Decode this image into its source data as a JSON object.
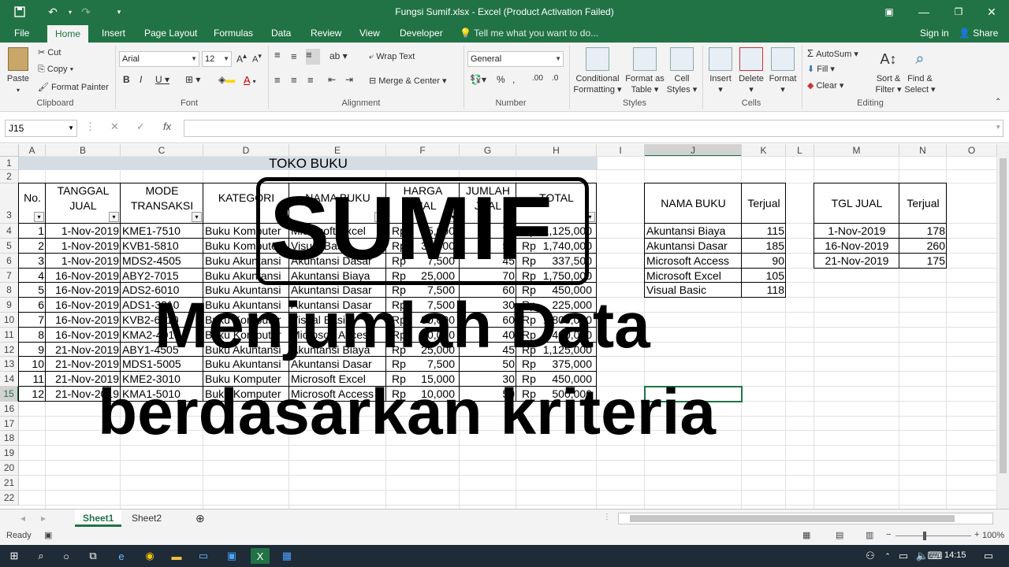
{
  "window": {
    "title": "Fungsi Sumif.xlsx - Excel (Product Activation Failed)",
    "qat": {
      "save_icon": "save-icon",
      "undo_icon": "undo-icon",
      "redo_icon": "redo-icon"
    }
  },
  "tabs": [
    "File",
    "Home",
    "Insert",
    "Page Layout",
    "Formulas",
    "Data",
    "Review",
    "View",
    "Developer"
  ],
  "tell_me": "Tell me what you want to do...",
  "sign_in": "Sign in",
  "share": "Share",
  "ribbon": {
    "clipboard": {
      "paste": "Paste",
      "cut": "Cut",
      "copy": "Copy",
      "format_painter": "Format Painter",
      "label": "Clipboard"
    },
    "font": {
      "name": "Arial",
      "size": "12",
      "label": "Font"
    },
    "alignment": {
      "wrap_text": "Wrap Text",
      "merge_center": "Merge & Center",
      "label": "Alignment"
    },
    "number": {
      "format": "General",
      "label": "Number"
    },
    "styles": {
      "conditional": "Conditional",
      "conditional2": "Formatting",
      "format_as": "Format as",
      "format_as2": "Table",
      "cell": "Cell",
      "cell2": "Styles",
      "label": "Styles"
    },
    "cells": {
      "insert": "Insert",
      "delete": "Delete",
      "format": "Format",
      "label": "Cells"
    },
    "editing": {
      "autosum": "AutoSum",
      "fill": "Fill",
      "clear": "Clear",
      "sort": "Sort &",
      "sort2": "Filter",
      "find": "Find &",
      "find2": "Select",
      "label": "Editing"
    }
  },
  "namebox": "J15",
  "columns": [
    "A",
    "B",
    "C",
    "D",
    "E",
    "F",
    "G",
    "H",
    "I",
    "J",
    "K",
    "L",
    "M",
    "N",
    "O"
  ],
  "rows": [
    "1",
    "2",
    "3",
    "4",
    "5",
    "6",
    "7",
    "8",
    "9",
    "10",
    "11",
    "12",
    "13",
    "14",
    "15",
    "16",
    "17",
    "18",
    "19",
    "20",
    "21",
    "22"
  ],
  "sheet": {
    "title": "TOKO BUKU",
    "headers": {
      "no": "No.",
      "tanggal1": "TANGGAL",
      "tanggal2": "JUAL",
      "mode1": "MODE",
      "mode2": "TRANSAKSI",
      "kategori": "KATEGORI",
      "nama": "NAMA BUKU",
      "harga1": "HARGA",
      "harga2": "JUAL",
      "jumlah1": "JUMLAH",
      "jumlah2": "JUAL",
      "total": "TOTAL"
    },
    "data": [
      [
        "1",
        "1-Nov-2019",
        "KME1-7510",
        "Buku Komputer",
        "Microsoft Excel",
        "Rp",
        "15,000",
        "75",
        "Rp",
        "1,125,000"
      ],
      [
        "2",
        "1-Nov-2019",
        "KVB1-5810",
        "Buku Komputer",
        "Visual Basic",
        "Rp",
        "35,000",
        "50",
        "Rp",
        "1,740,000"
      ],
      [
        "3",
        "1-Nov-2019",
        "MDS2-4505",
        "Buku Akuntansi",
        "Akuntansi Dasar",
        "Rp",
        "7,500",
        "45",
        "Rp",
        "337,500"
      ],
      [
        "4",
        "16-Nov-2019",
        "ABY2-7015",
        "Buku Akuntansi",
        "Akuntansi Biaya",
        "Rp",
        "25,000",
        "70",
        "Rp",
        "1,750,000"
      ],
      [
        "5",
        "16-Nov-2019",
        "ADS2-6010",
        "Buku Akuntansi",
        "Akuntansi Dasar",
        "Rp",
        "7,500",
        "60",
        "Rp",
        "450,000"
      ],
      [
        "6",
        "16-Nov-2019",
        "ADS1-3010",
        "Buku Akuntansi",
        "Akuntansi Dasar",
        "Rp",
        "7,500",
        "30",
        "Rp",
        "225,000"
      ],
      [
        "7",
        "16-Nov-2019",
        "KVB2-6010",
        "Buku Komputer",
        "Visual Basic",
        "Rp",
        "30,000",
        "60",
        "Rp",
        "1,800,000"
      ],
      [
        "8",
        "16-Nov-2019",
        "KMA2-4010",
        "Buku Komputer",
        "Microsoft Access",
        "Rp",
        "10,000",
        "40",
        "Rp",
        "400,000"
      ],
      [
        "9",
        "21-Nov-2019",
        "ABY1-4505",
        "Buku Akuntansi",
        "Akuntansi Biaya",
        "Rp",
        "25,000",
        "45",
        "Rp",
        "1,125,000"
      ],
      [
        "10",
        "21-Nov-2019",
        "MDS1-5005",
        "Buku Akuntansi",
        "Akuntansi Dasar",
        "Rp",
        "7,500",
        "50",
        "Rp",
        "375,000"
      ],
      [
        "11",
        "21-Nov-2019",
        "KME2-3010",
        "Buku Komputer",
        "Microsoft Excel",
        "Rp",
        "15,000",
        "30",
        "Rp",
        "450,000"
      ],
      [
        "12",
        "21-Nov-2019",
        "KMA1-5010",
        "Buku Komputer",
        "Microsoft Access",
        "Rp",
        "10,000",
        "50",
        "Rp",
        "500,000"
      ]
    ],
    "summary1": {
      "h1": "NAMA BUKU",
      "h2": "Terjual",
      "rows": [
        [
          "Akuntansi Biaya",
          "115"
        ],
        [
          "Akuntansi Dasar",
          "185"
        ],
        [
          "Microsoft Access",
          "90"
        ],
        [
          "Microsoft Excel",
          "105"
        ],
        [
          "Visual Basic",
          "118"
        ]
      ]
    },
    "summary2": {
      "h1": "TGL JUAL",
      "h2": "Terjual",
      "rows": [
        [
          "1-Nov-2019",
          "178"
        ],
        [
          "16-Nov-2019",
          "260"
        ],
        [
          "21-Nov-2019",
          "175"
        ]
      ]
    }
  },
  "overlay": {
    "big": "SUMIF",
    "line1": "Menjumlah Data",
    "line2": "berdasarkan kriteria"
  },
  "sheet_tabs": [
    "Sheet1",
    "Sheet2"
  ],
  "status": {
    "ready": "Ready",
    "zoom": "100%"
  },
  "taskbar": {
    "time": "14:15"
  }
}
